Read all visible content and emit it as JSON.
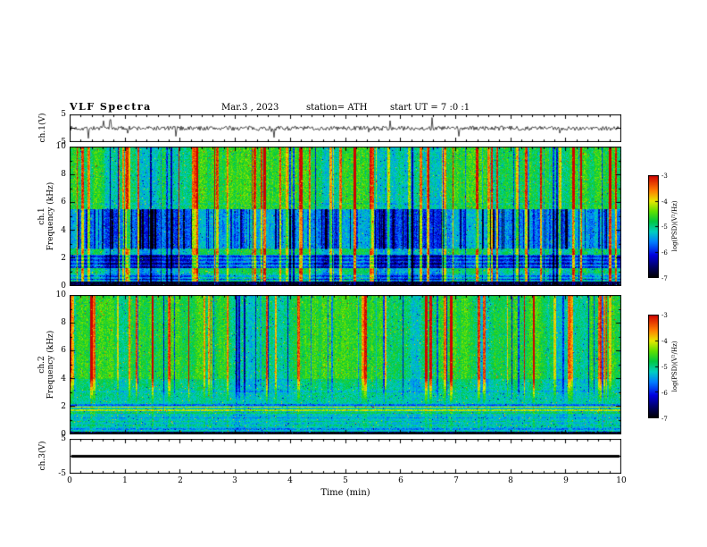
{
  "title": {
    "main": "VLF Spectra",
    "date": "Mar.3 , 2023",
    "station": "station= ATH",
    "start_ut": "start UT =  7 :0 :1"
  },
  "x_axis": {
    "label": "Time (min)",
    "lim": [
      0,
      10
    ],
    "ticks": [
      0,
      1,
      2,
      3,
      4,
      5,
      6,
      7,
      8,
      9,
      10
    ]
  },
  "colorbar": {
    "label": "log(PSD)(V²/Hz)",
    "ticks": [
      -3,
      -4,
      -5,
      -6,
      -7
    ],
    "range": [
      -7,
      -3
    ],
    "stops": [
      {
        "t": 0.0,
        "c": "#000000"
      },
      {
        "t": 0.1,
        "c": "#000060"
      },
      {
        "t": 0.22,
        "c": "#0000e0"
      },
      {
        "t": 0.35,
        "c": "#0080ff"
      },
      {
        "t": 0.45,
        "c": "#00d0c0"
      },
      {
        "t": 0.55,
        "c": "#00c840"
      },
      {
        "t": 0.65,
        "c": "#60e000"
      },
      {
        "t": 0.75,
        "c": "#e8e800"
      },
      {
        "t": 0.85,
        "c": "#ff8000"
      },
      {
        "t": 1.0,
        "c": "#d00000"
      }
    ]
  },
  "chart_data": [
    {
      "id": "ch1_waveform",
      "type": "line",
      "ylabel": "ch.1(V)",
      "ylim": [
        -5,
        5
      ],
      "yticks": [
        5,
        -5
      ],
      "xlim": [
        0,
        10
      ],
      "typical_amplitude_v": 1,
      "spike_amplitude_v": 4,
      "signal": "broadband noise centered on 0 V with frequent impulsive spikes to about ±4 V over the whole 10 min record"
    },
    {
      "id": "ch1_spectrogram",
      "type": "heatmap",
      "ylabel_line1": "ch.1",
      "ylabel_line2": "Frequency (kHz)",
      "ylim_khz": [
        0,
        10
      ],
      "yticks": [
        10,
        8,
        6,
        4,
        2,
        0
      ],
      "xlim": [
        0,
        10
      ],
      "value_range_log_psd": [
        -7,
        -3
      ],
      "features": [
        "near-black band below ~0.3 kHz",
        "attenuated dark-blue band ~1.2-2.2 kHz containing several darker horizontal lines",
        "broad dark-blue band ~2.6-5.5 kHz with dense dark vertical striations",
        "green background above ~5.5 kHz",
        "many bright yellow/red vertical streaks (impulsive events) crossing all frequencies throughout the record"
      ]
    },
    {
      "id": "ch2_spectrogram",
      "type": "heatmap",
      "ylabel_line1": "ch.2",
      "ylabel_line2": "Frequency (kHz)",
      "ylim_khz": [
        0,
        10
      ],
      "yticks": [
        10,
        8,
        6,
        4,
        2,
        0
      ],
      "xlim": [
        0,
        10
      ],
      "value_range_log_psd": [
        -7,
        -3
      ],
      "features": [
        "thin near-black line below ~0.15 kHz",
        "uniform cyan band below ~2 kHz with fine horizontal striations",
        "two bright yellow/orange horizontal lines near 1.7 and 1.9 kHz",
        "green background above ~4 kHz with many yellow/red vertical streaks",
        "vertical streaks fade out below ~2 kHz"
      ]
    },
    {
      "id": "ch3_waveform",
      "type": "line",
      "ylabel": "ch.3(V)",
      "ylim": [
        -5,
        5
      ],
      "yticks": [
        5,
        -5
      ],
      "xlim": [
        0,
        10
      ],
      "flat_value_v": 0,
      "signal": "constant 0 V - flat thick black line for the whole record"
    }
  ]
}
